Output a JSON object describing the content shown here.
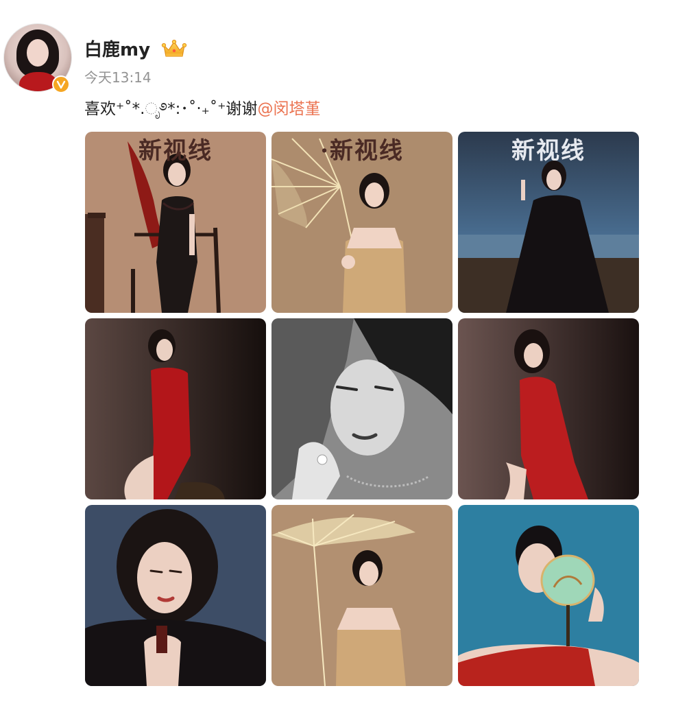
{
  "post": {
    "author": {
      "name": "白鹿my",
      "avatar_icon": "user-avatar",
      "badge_icon": "verified-v-icon",
      "badge_letter": "V",
      "member_icon": "crown-icon"
    },
    "timestamp": "今天13:14",
    "text_prefix": "喜欢⁺˚*.ೃ࿔*:･˚‧₊˚⁺谢谢",
    "mention": "@闵塔堇",
    "images": [
      {
        "title": "新视线",
        "icon": "photo-red-dress-chair"
      },
      {
        "title": "·新视线",
        "icon": "photo-gold-umbrella"
      },
      {
        "title": "新视线",
        "icon": "photo-black-gown-seaside"
      },
      {
        "title": "",
        "icon": "photo-red-slip-dress"
      },
      {
        "title": "",
        "icon": "photo-bw-closeup"
      },
      {
        "title": "",
        "icon": "photo-red-dress-seated"
      },
      {
        "title": "",
        "icon": "photo-portrait-blue-backdrop"
      },
      {
        "title": "",
        "icon": "photo-gold-umbrella-2"
      },
      {
        "title": "",
        "icon": "photo-fan-blue-backdrop"
      }
    ]
  },
  "colors": {
    "mention": "#eb7350",
    "username": "#222222",
    "timestamp": "#939393",
    "badge": "#f5a623"
  }
}
